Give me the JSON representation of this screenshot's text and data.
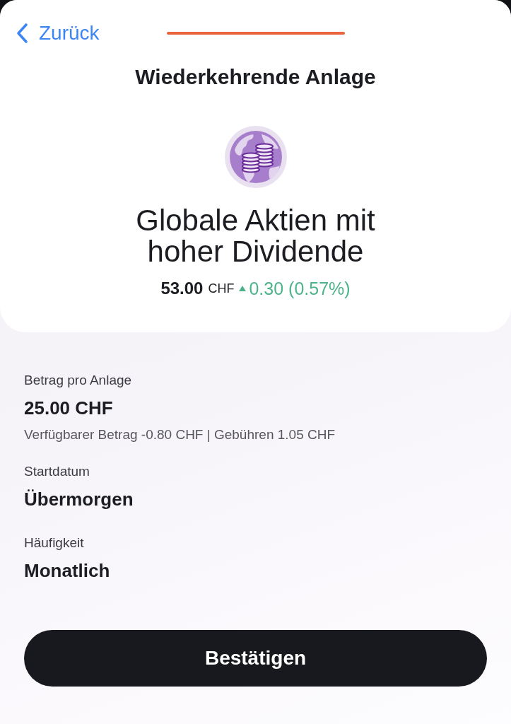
{
  "nav": {
    "back_label": "Zurück"
  },
  "title": "Wiederkehrende Anlage",
  "product": {
    "name": "Globale Aktien mit hoher Dividende",
    "price": "53.00",
    "currency": "CHF",
    "change_positive": true,
    "change": "0.30 (0.57%)"
  },
  "fields": [
    {
      "label": "Betrag pro Anlage",
      "value": "25.00 CHF",
      "note": "Verfügbarer Betrag -0.80 CHF | Gebühren 1.05 CHF"
    },
    {
      "label": "Startdatum",
      "value": "Übermorgen"
    },
    {
      "label": "Häufigkeit",
      "value": "Monatlich"
    }
  ],
  "buttons": [
    "Bestätigen"
  ]
}
